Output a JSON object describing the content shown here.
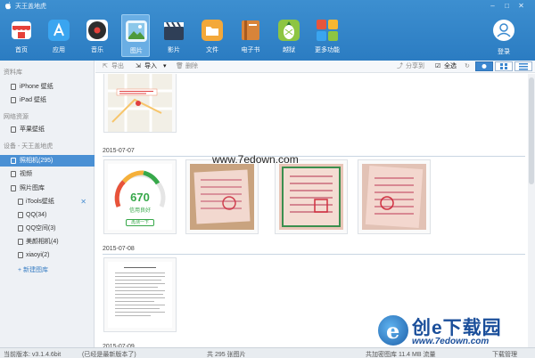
{
  "window": {
    "title": "天王盖地虎"
  },
  "nav": {
    "items": [
      {
        "label": "首页",
        "icon": "shop-icon",
        "color": "#e5413a"
      },
      {
        "label": "应用",
        "icon": "app-store-icon",
        "color": "#3aa5f0"
      },
      {
        "label": "音乐",
        "icon": "music-disc-icon",
        "color": "#2d2d2d"
      },
      {
        "label": "图片",
        "icon": "photo-icon",
        "color": "#8cc8ea",
        "active": true
      },
      {
        "label": "影片",
        "icon": "clapper-icon",
        "color": "#2f3f57"
      },
      {
        "label": "文件",
        "icon": "folder-icon",
        "color": "#f3a83a"
      },
      {
        "label": "电子书",
        "icon": "book-icon",
        "color": "#d8843a"
      },
      {
        "label": "越狱",
        "icon": "pineapple-icon",
        "color": "#8dc542"
      },
      {
        "label": "更多功能",
        "icon": "grid-icon",
        "color": "#e6553c"
      }
    ],
    "login_label": "登录"
  },
  "sidebar": {
    "section_library": "资料库",
    "iphone_wallpaper": "iPhone 壁纸",
    "ipad_wallpaper": "iPad 壁纸",
    "section_network": "网络资源",
    "apple_wallpaper": "苹果壁纸",
    "section_device": "设备 - 天王盖地虎",
    "camera_roll": "照相机(295)",
    "video": "视频",
    "photo_library": "照片图库",
    "albums": [
      {
        "label": "iTools壁纸",
        "removable": true
      },
      {
        "label": "QQ(34)"
      },
      {
        "label": "QQ空间(3)"
      },
      {
        "label": "美颜相机(4)"
      },
      {
        "label": "xiaoyi(2)"
      }
    ],
    "new_album": "+ 新建图库"
  },
  "toolbar": {
    "export": "导出",
    "import": "导入",
    "delete": "删除",
    "share": "分享到",
    "select_all": "全选"
  },
  "content": {
    "groups": [
      {
        "date": "2015-07-07"
      },
      {
        "date": "2015-07-08"
      },
      {
        "date": "2015-07-09"
      }
    ],
    "gauge": {
      "score": "670",
      "caption": "信用良好",
      "button": "再测一下"
    }
  },
  "statusbar": {
    "version": "当前版本: v3.1.4.6bit",
    "update": "(已经是最新版本了)",
    "count": "共 295 张图片",
    "storage": "共加密图库 11.4 MB 流量",
    "download": "下载管理"
  },
  "watermark": {
    "url_top": "www.7edown.com",
    "brand": "创e下载园",
    "url_bottom": "www.7edown.com"
  }
}
